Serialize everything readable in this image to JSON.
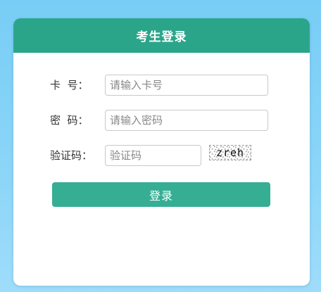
{
  "login": {
    "title": "考生登录",
    "card_no": {
      "label": "卡  号：",
      "placeholder": "请输入卡号",
      "value": ""
    },
    "password": {
      "label": "密  码：",
      "placeholder": "请输入密码",
      "value": ""
    },
    "captcha": {
      "label": "验证码：",
      "placeholder": "验证码",
      "value": "",
      "image_text": "zreh"
    },
    "submit_label": "登录"
  },
  "colors": {
    "header": "#2ba58a",
    "button": "#35ae94",
    "background": "#7fd0f7"
  }
}
